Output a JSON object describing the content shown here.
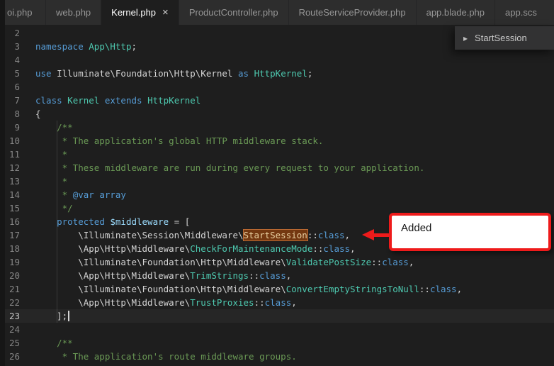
{
  "colors": {
    "keyword": "#569cd6",
    "type": "#4ec9b0",
    "comment": "#6a9955",
    "variable": "#9cdcfe",
    "accent_red": "#ee1b1b",
    "match_highlight": "#ea5c00"
  },
  "tabbar": {
    "tabs": [
      {
        "label": "oi.php"
      },
      {
        "label": "web.php"
      },
      {
        "label": "Kernel.php",
        "close": "×"
      },
      {
        "label": "ProductController.php"
      },
      {
        "label": "RouteServiceProvider.php"
      },
      {
        "label": "app.blade.php"
      },
      {
        "label": "app.scs"
      }
    ]
  },
  "popup": {
    "chevron": "▸",
    "label": "StartSession"
  },
  "annotation": {
    "label": "Added"
  },
  "editor": {
    "lines": [
      {
        "num": "2",
        "segments": []
      },
      {
        "num": "3",
        "segments": [
          {
            "c": "kw",
            "t": "namespace"
          },
          {
            "c": "pl",
            "t": " "
          },
          {
            "c": "type",
            "t": "App\\Http"
          },
          {
            "c": "pl",
            "t": ";"
          }
        ]
      },
      {
        "num": "4",
        "segments": []
      },
      {
        "num": "5",
        "segments": [
          {
            "c": "kw",
            "t": "use"
          },
          {
            "c": "pl",
            "t": " Illuminate\\Foundation\\Http\\Kernel "
          },
          {
            "c": "kw",
            "t": "as"
          },
          {
            "c": "pl",
            "t": " "
          },
          {
            "c": "type",
            "t": "HttpKernel"
          },
          {
            "c": "pl",
            "t": ";"
          }
        ]
      },
      {
        "num": "6",
        "segments": []
      },
      {
        "num": "7",
        "segments": [
          {
            "c": "kw",
            "t": "class"
          },
          {
            "c": "pl",
            "t": " "
          },
          {
            "c": "type",
            "t": "Kernel"
          },
          {
            "c": "pl",
            "t": " "
          },
          {
            "c": "kw",
            "t": "extends"
          },
          {
            "c": "pl",
            "t": " "
          },
          {
            "c": "type",
            "t": "HttpKernel"
          }
        ]
      },
      {
        "num": "8",
        "segments": [
          {
            "c": "pl",
            "t": "{"
          }
        ]
      },
      {
        "num": "9",
        "segments": [
          {
            "c": "cm",
            "t": "    /**"
          }
        ]
      },
      {
        "num": "10",
        "segments": [
          {
            "c": "cm",
            "t": "     * The application's global HTTP middleware stack."
          }
        ]
      },
      {
        "num": "11",
        "segments": [
          {
            "c": "cm",
            "t": "     *"
          }
        ]
      },
      {
        "num": "12",
        "segments": [
          {
            "c": "cm",
            "t": "     * These middleware are run during every request to your application."
          }
        ]
      },
      {
        "num": "13",
        "segments": [
          {
            "c": "cm",
            "t": "     *"
          }
        ]
      },
      {
        "num": "14",
        "segments": [
          {
            "c": "cm",
            "t": "     * "
          },
          {
            "c": "doc",
            "t": "@var array"
          }
        ]
      },
      {
        "num": "15",
        "segments": [
          {
            "c": "cm",
            "t": "     */"
          }
        ]
      },
      {
        "num": "16",
        "segments": [
          {
            "c": "pl",
            "t": "    "
          },
          {
            "c": "kw",
            "t": "protected"
          },
          {
            "c": "pl",
            "t": " "
          },
          {
            "c": "var",
            "t": "$middleware"
          },
          {
            "c": "pl",
            "t": " = ["
          }
        ]
      },
      {
        "num": "17",
        "segments": [
          {
            "c": "pl",
            "t": "        \\Illuminate\\Session\\Middleware\\"
          },
          {
            "c": "match",
            "t": "StartSession"
          },
          {
            "c": "pl",
            "t": "::"
          },
          {
            "c": "kw",
            "t": "class"
          },
          {
            "c": "pl",
            "t": ","
          }
        ]
      },
      {
        "num": "18",
        "segments": [
          {
            "c": "pl",
            "t": "        \\App\\Http\\Middleware\\"
          },
          {
            "c": "type",
            "t": "CheckForMaintenanceMode"
          },
          {
            "c": "pl",
            "t": "::"
          },
          {
            "c": "kw",
            "t": "class"
          },
          {
            "c": "pl",
            "t": ","
          }
        ]
      },
      {
        "num": "19",
        "segments": [
          {
            "c": "pl",
            "t": "        \\Illuminate\\Foundation\\Http\\Middleware\\"
          },
          {
            "c": "type",
            "t": "ValidatePostSize"
          },
          {
            "c": "pl",
            "t": "::"
          },
          {
            "c": "kw",
            "t": "class"
          },
          {
            "c": "pl",
            "t": ","
          }
        ]
      },
      {
        "num": "20",
        "segments": [
          {
            "c": "pl",
            "t": "        \\App\\Http\\Middleware\\"
          },
          {
            "c": "type",
            "t": "TrimStrings"
          },
          {
            "c": "pl",
            "t": "::"
          },
          {
            "c": "kw",
            "t": "class"
          },
          {
            "c": "pl",
            "t": ","
          }
        ]
      },
      {
        "num": "21",
        "segments": [
          {
            "c": "pl",
            "t": "        \\Illuminate\\Foundation\\Http\\Middleware\\"
          },
          {
            "c": "type",
            "t": "ConvertEmptyStringsToNull"
          },
          {
            "c": "pl",
            "t": "::"
          },
          {
            "c": "kw",
            "t": "class"
          },
          {
            "c": "pl",
            "t": ","
          }
        ]
      },
      {
        "num": "22",
        "segments": [
          {
            "c": "pl",
            "t": "        \\App\\Http\\Middleware\\"
          },
          {
            "c": "type",
            "t": "TrustProxies"
          },
          {
            "c": "pl",
            "t": "::"
          },
          {
            "c": "kw",
            "t": "class"
          },
          {
            "c": "pl",
            "t": ","
          }
        ]
      },
      {
        "num": "23",
        "active": true,
        "cursor": true,
        "segments": [
          {
            "c": "pl",
            "t": "    ];"
          }
        ]
      },
      {
        "num": "24",
        "segments": []
      },
      {
        "num": "25",
        "segments": [
          {
            "c": "cm",
            "t": "    /**"
          }
        ]
      },
      {
        "num": "26",
        "segments": [
          {
            "c": "cm",
            "t": "     * The application's route middleware groups."
          }
        ]
      }
    ]
  }
}
